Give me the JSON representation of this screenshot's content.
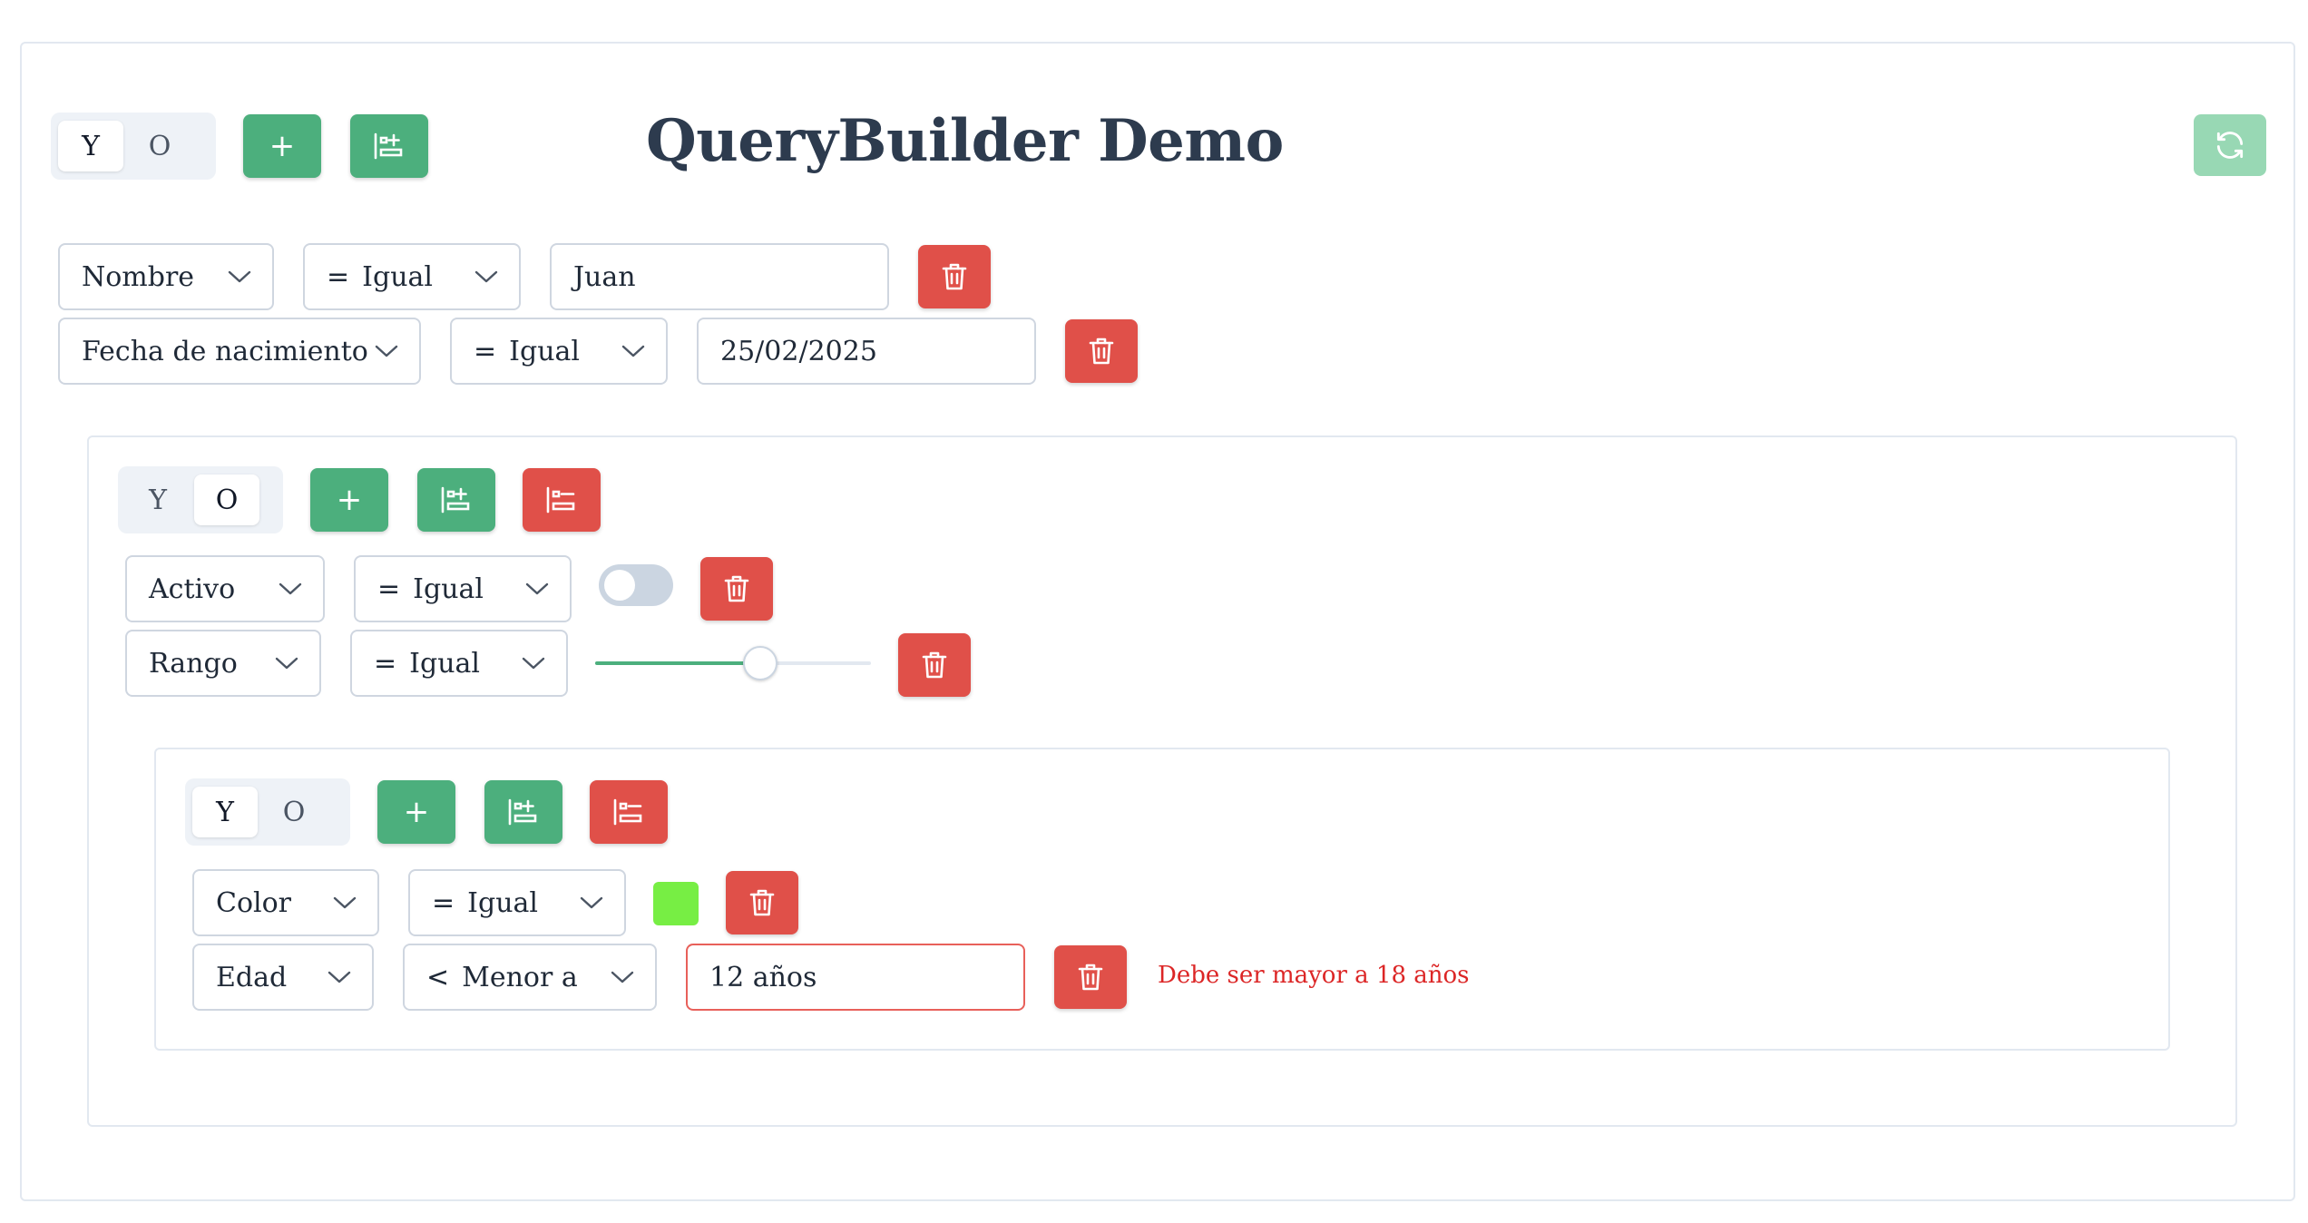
{
  "title": "QueryBuilder Demo",
  "combinator_options": [
    "Y",
    "O"
  ],
  "root": {
    "combinator": "Y",
    "rules": [
      {
        "field": "Nombre",
        "operator_symbol": "=",
        "operator": "Igual",
        "value": "Juan"
      },
      {
        "field": "Fecha de nacimiento",
        "operator_symbol": "=",
        "operator": "Igual",
        "value": "25/02/2025"
      }
    ]
  },
  "group1": {
    "combinator": "O",
    "rules": [
      {
        "field": "Activo",
        "operator_symbol": "=",
        "operator": "Igual",
        "value": false
      },
      {
        "field": "Rango",
        "operator_symbol": "=",
        "operator": "Igual",
        "value": 0.6
      }
    ]
  },
  "group2": {
    "combinator": "Y",
    "rules": [
      {
        "field": "Color",
        "operator_symbol": "=",
        "operator": "Igual",
        "value": "#77ee44"
      },
      {
        "field": "Edad",
        "operator_symbol": "<",
        "operator": "Menor a",
        "value": "12 años",
        "error": "Debe ser mayor a 18 años"
      }
    ]
  },
  "icons": {
    "add_rule": "plus-icon",
    "add_group": "add-group-icon",
    "remove_group": "remove-group-icon",
    "remove_rule": "trash-icon",
    "reset": "refresh-icon",
    "dropdown": "chevron-down-icon"
  },
  "colors": {
    "green": "#4caf7d",
    "red": "#e05049",
    "error": "#dc2626",
    "reset_button": "#98d8b4"
  }
}
